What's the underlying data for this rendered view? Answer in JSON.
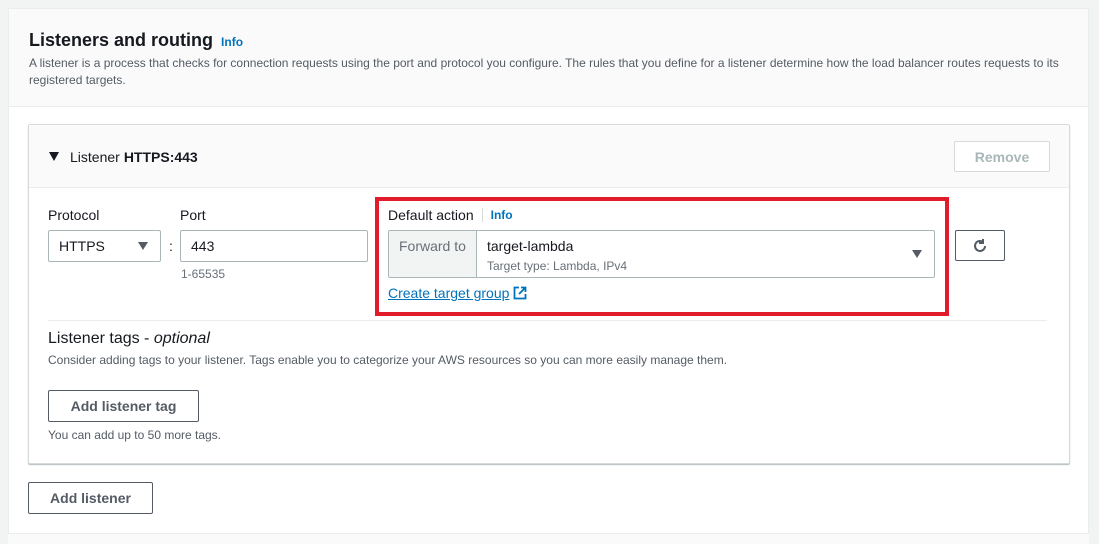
{
  "section": {
    "title": "Listeners and routing",
    "info": "Info",
    "description": "A listener is a process that checks for connection requests using the port and protocol you configure. The rules that you define for a listener determine how the load balancer routes requests to its registered targets."
  },
  "listener": {
    "label": "Listener",
    "protocol_port": "HTTPS:443",
    "remove_label": "Remove",
    "protocol_label": "Protocol",
    "protocol_value": "HTTPS",
    "separator": ":",
    "port_label": "Port",
    "port_value": "443",
    "port_hint": "1-65535",
    "default_action": {
      "label": "Default action",
      "info": "Info",
      "prefix": "Forward to",
      "value": "target-lambda",
      "sub": "Target type: Lambda, IPv4",
      "create_link": "Create target group"
    }
  },
  "tags": {
    "title": "Listener tags - ",
    "title_optional": "optional",
    "description": "Consider adding tags to your listener. Tags enable you to categorize your AWS resources so you can more easily manage them.",
    "add_button": "Add listener tag",
    "hint": "You can add up to 50 more tags."
  },
  "footer": {
    "add_listener": "Add listener"
  },
  "colors": {
    "highlight": "#e21b2b",
    "link": "#0073bb"
  }
}
